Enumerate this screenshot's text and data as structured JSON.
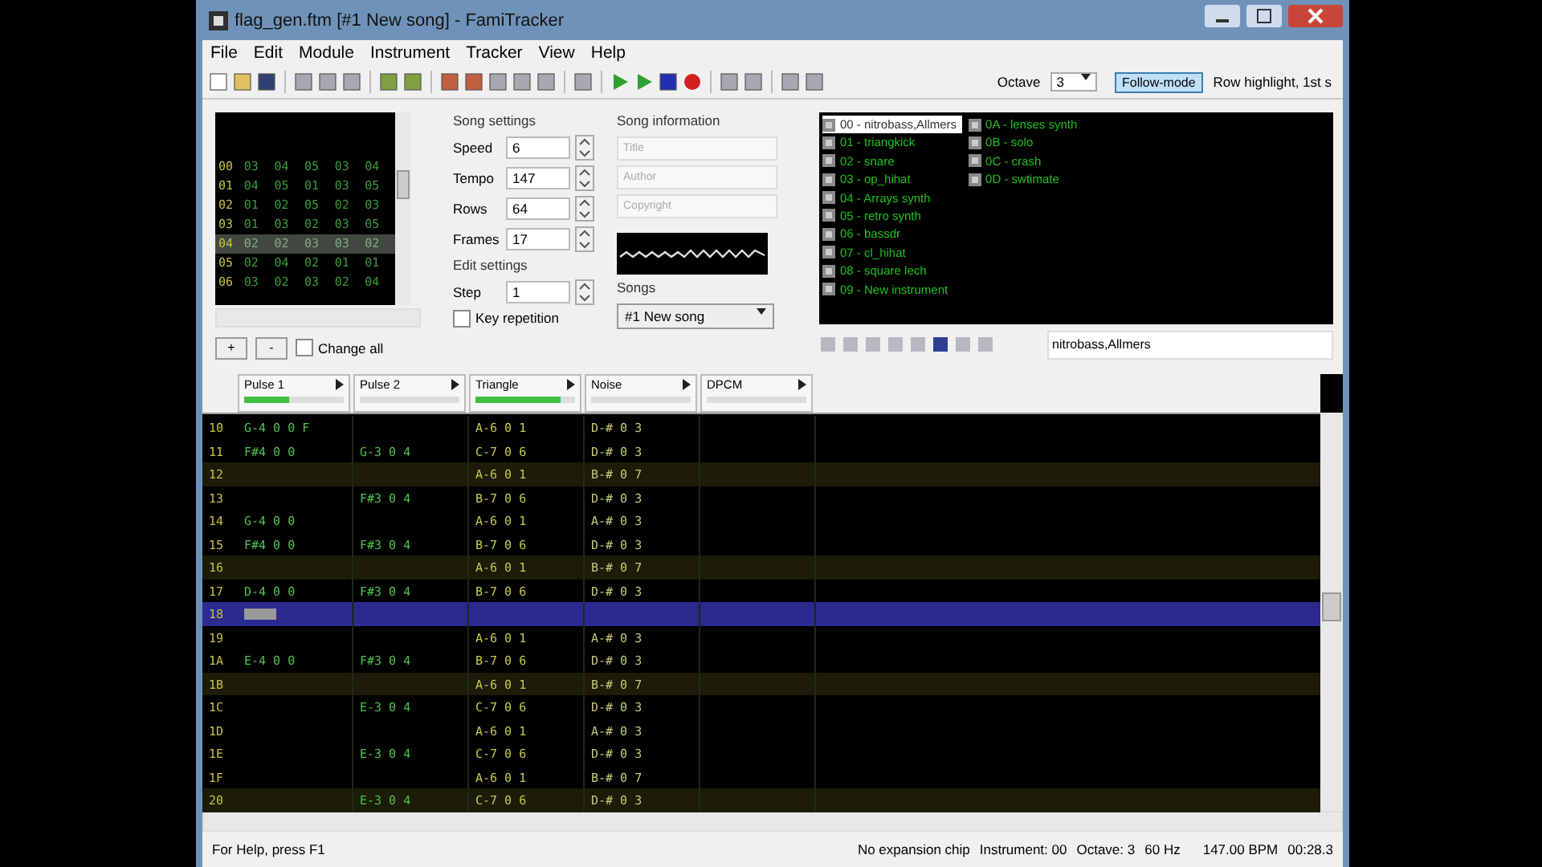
{
  "window": {
    "title": "flag_gen.ftm [#1 New song] - FamiTracker"
  },
  "menu": [
    "File",
    "Edit",
    "Module",
    "Instrument",
    "Tracker",
    "View",
    "Help"
  ],
  "toolbar": {
    "octave_label": "Octave",
    "octave": "3",
    "follow_mode": {
      "label": "Follow-mode",
      "selected": true
    },
    "row_highlight": "Row highlight, 1st s"
  },
  "frames": {
    "rows": [
      {
        "num": "00",
        "cells": [
          "03",
          "04",
          "05",
          "03",
          "04"
        ],
        "selected": false
      },
      {
        "num": "01",
        "cells": [
          "04",
          "05",
          "01",
          "03",
          "05"
        ],
        "selected": false
      },
      {
        "num": "02",
        "cells": [
          "01",
          "02",
          "05",
          "02",
          "03"
        ],
        "selected": false
      },
      {
        "num": "03",
        "cells": [
          "01",
          "03",
          "02",
          "03",
          "05"
        ],
        "selected": false
      },
      {
        "num": "04",
        "cells": [
          "02",
          "02",
          "03",
          "03",
          "02"
        ],
        "selected": true
      },
      {
        "num": "05",
        "cells": [
          "02",
          "04",
          "02",
          "01",
          "01"
        ],
        "selected": false
      },
      {
        "num": "06",
        "cells": [
          "03",
          "02",
          "03",
          "02",
          "04"
        ],
        "selected": false
      }
    ],
    "add": "+",
    "remove": "-",
    "change_all": {
      "label": "Change all",
      "checked": false
    }
  },
  "song_settings": {
    "title": "Song settings",
    "fields": [
      {
        "label": "Speed",
        "value": "6"
      },
      {
        "label": "Tempo",
        "value": "147"
      },
      {
        "label": "Rows",
        "value": "64"
      },
      {
        "label": "Frames",
        "value": "17"
      }
    ]
  },
  "edit_settings": {
    "title": "Edit settings",
    "step_label": "Step",
    "step": "1",
    "key_repetition": {
      "label": "Key repetition",
      "checked": false
    }
  },
  "song_information": {
    "title": "Song information",
    "fields": [
      {
        "placeholder": "Title"
      },
      {
        "placeholder": "Author"
      },
      {
        "placeholder": "Copyright"
      }
    ],
    "songs_label": "Songs",
    "song": "#1 New song"
  },
  "instruments": {
    "items": [
      {
        "label": "00 - nitrobass,Allmers",
        "selected": true
      },
      {
        "label": "01 - triangkick",
        "selected": false
      },
      {
        "label": "02 - snare",
        "selected": false
      },
      {
        "label": "03 - op_hihat",
        "selected": false
      },
      {
        "label": "04 - Arrays synth",
        "selected": false
      },
      {
        "label": "05 - retro synth",
        "selected": false
      },
      {
        "label": "06 - bassdr",
        "selected": false
      },
      {
        "label": "07 - cl_hihat",
        "selected": false
      },
      {
        "label": "08 - square lech",
        "selected": false
      },
      {
        "label": "09 - New instrument",
        "selected": false
      },
      {
        "label": "0A - lenses synth",
        "selected": false
      },
      {
        "label": "0B - solo",
        "selected": false
      },
      {
        "label": "0C - crash",
        "selected": false
      },
      {
        "label": "0D - swtimate",
        "selected": false
      }
    ],
    "name": "nitrobass,Allmers"
  },
  "channels": [
    {
      "name": "Pulse 1",
      "level": 0.45
    },
    {
      "name": "Pulse 2",
      "level": 0
    },
    {
      "name": "Triangle",
      "level": 0.85
    },
    {
      "name": "Noise",
      "level": 0
    },
    {
      "name": "DPCM",
      "level": 0
    }
  ],
  "pattern": {
    "rows": [
      {
        "num": "10",
        "selected": false,
        "highlight": false,
        "cells": [
          "G-4 0 0 F",
          "",
          "A-6 0 1",
          "D-# 0 3",
          ""
        ]
      },
      {
        "num": "11",
        "selected": false,
        "highlight": false,
        "cells": [
          "F#4 0 0",
          "G-3 0 4",
          "C-7 0 6",
          "D-# 0 3",
          ""
        ]
      },
      {
        "num": "12",
        "selected": false,
        "highlight": true,
        "cells": [
          "",
          "",
          "A-6 0 1",
          "B-# 0 7",
          ""
        ]
      },
      {
        "num": "13",
        "selected": false,
        "highlight": false,
        "cells": [
          "",
          "F#3 0 4",
          "B-7 0 6",
          "D-# 0 3",
          ""
        ]
      },
      {
        "num": "14",
        "selected": false,
        "highlight": false,
        "cells": [
          "G-4 0 0",
          "",
          "A-6 0 1",
          "A-# 0 3",
          ""
        ]
      },
      {
        "num": "15",
        "selected": false,
        "highlight": false,
        "cells": [
          "F#4 0 0",
          "F#3 0 4",
          "B-7 0 6",
          "D-# 0 3",
          ""
        ]
      },
      {
        "num": "16",
        "selected": false,
        "highlight": true,
        "cells": [
          "",
          "",
          "A-6 0 1",
          "B-# 0 7",
          ""
        ]
      },
      {
        "num": "17",
        "selected": false,
        "highlight": false,
        "cells": [
          "D-4 0 0",
          "F#3 0 4",
          "B-7 0 6",
          "D-# 0 3",
          ""
        ]
      },
      {
        "num": "18",
        "selected": true,
        "highlight": false,
        "cells": [
          "",
          "",
          "",
          "",
          ""
        ]
      },
      {
        "num": "19",
        "selected": false,
        "highlight": false,
        "cells": [
          "",
          "",
          "A-6 0 1",
          "A-# 0 3",
          ""
        ]
      },
      {
        "num": "1A",
        "selected": false,
        "highlight": false,
        "cells": [
          "E-4 0 0",
          "F#3 0 4",
          "B-7 0 6",
          "D-# 0 3",
          ""
        ]
      },
      {
        "num": "1B",
        "selected": false,
        "highlight": true,
        "cells": [
          "",
          "",
          "A-6 0 1",
          "B-# 0 7",
          ""
        ]
      },
      {
        "num": "1C",
        "selected": false,
        "highlight": false,
        "cells": [
          "",
          "E-3 0 4",
          "C-7 0 6",
          "D-# 0 3",
          ""
        ]
      },
      {
        "num": "1D",
        "selected": false,
        "highlight": false,
        "cells": [
          "",
          "",
          "A-6 0 1",
          "A-# 0 3",
          ""
        ]
      },
      {
        "num": "1E",
        "selected": false,
        "highlight": false,
        "cells": [
          "",
          "E-3 0 4",
          "C-7 0 6",
          "D-# 0 3",
          ""
        ]
      },
      {
        "num": "1F",
        "selected": false,
        "highlight": false,
        "cells": [
          "",
          "",
          "A-6 0 1",
          "B-# 0 7",
          ""
        ]
      },
      {
        "num": "20",
        "selected": false,
        "highlight": true,
        "cells": [
          "",
          "E-3 0 4",
          "C-7 0 6",
          "D-# 0 3",
          ""
        ]
      }
    ]
  },
  "status_bar": {
    "help": "For Help, press F1",
    "chip": "No expansion chip",
    "instrument": "Instrument: 00",
    "octave": "Octave: 3",
    "rate": "60 Hz",
    "bpm": "147.00 BPM",
    "time": "00:28.3"
  }
}
